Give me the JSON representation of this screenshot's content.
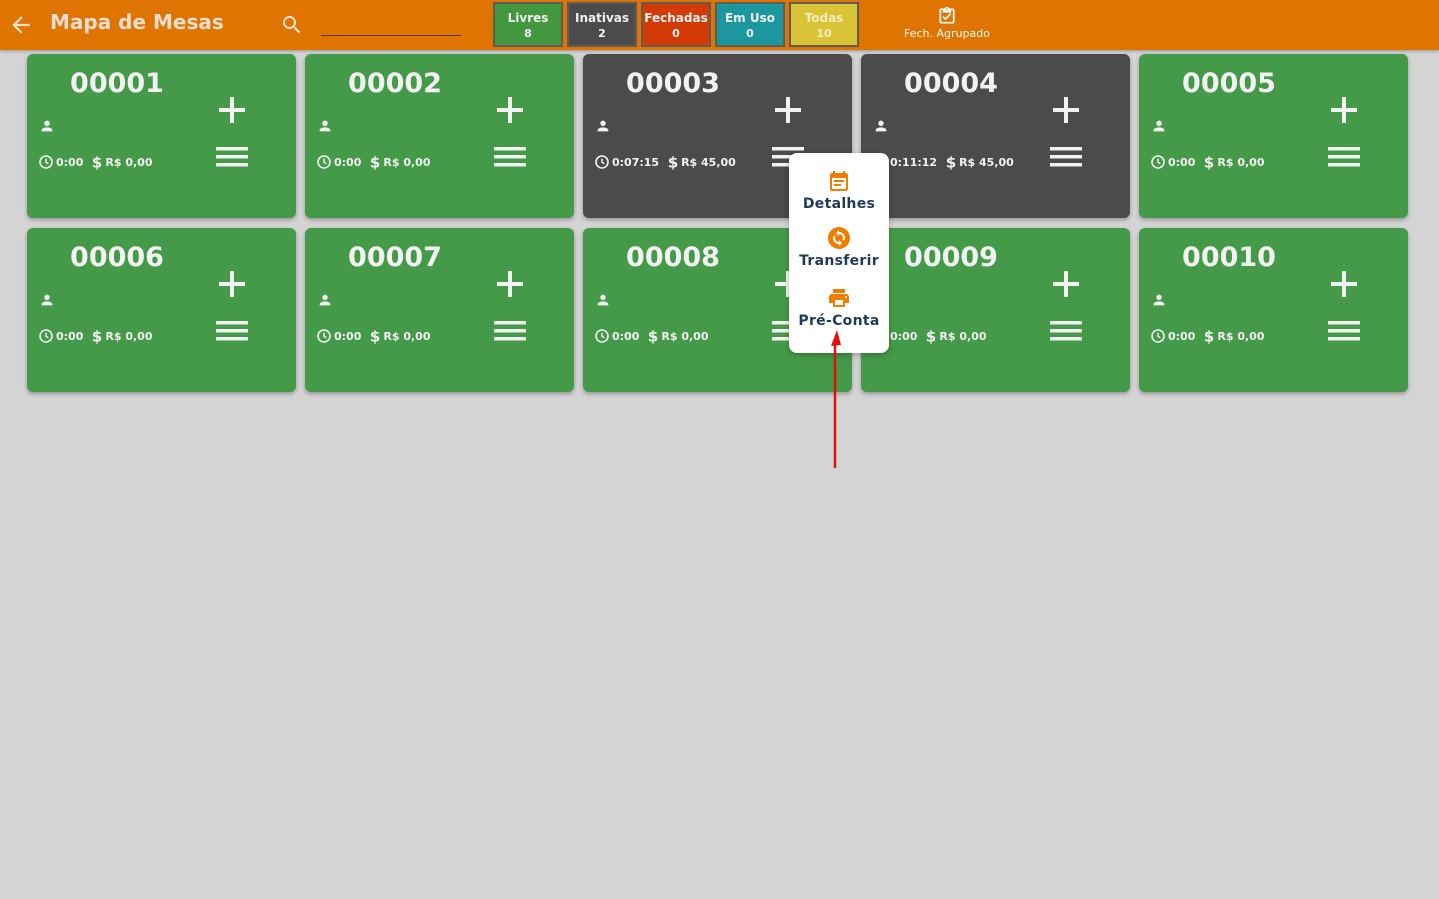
{
  "header": {
    "title": "Mapa de Mesas",
    "search_placeholder": "",
    "filters": [
      {
        "label": "Livres",
        "count": "8"
      },
      {
        "label": "Inativas",
        "count": "2"
      },
      {
        "label": "Fechadas",
        "count": "0"
      },
      {
        "label": "Em Uso",
        "count": "0"
      },
      {
        "label": "Todas",
        "count": "10"
      }
    ],
    "grouped_close_label": "Fech. Agrupado"
  },
  "tables": [
    {
      "number": "00001",
      "status": "livre",
      "time": "0:00",
      "amount": "R$ 0,00"
    },
    {
      "number": "00002",
      "status": "livre",
      "time": "0:00",
      "amount": "R$ 0,00"
    },
    {
      "number": "00003",
      "status": "inativa",
      "time": "0:07:15",
      "amount": "R$ 45,00"
    },
    {
      "number": "00004",
      "status": "inativa",
      "time": "0:11:12",
      "amount": "R$ 45,00"
    },
    {
      "number": "00005",
      "status": "livre",
      "time": "0:00",
      "amount": "R$ 0,00"
    },
    {
      "number": "00006",
      "status": "livre",
      "time": "0:00",
      "amount": "R$ 0,00"
    },
    {
      "number": "00007",
      "status": "livre",
      "time": "0:00",
      "amount": "R$ 0,00"
    },
    {
      "number": "00008",
      "status": "livre",
      "time": "0:00",
      "amount": "R$ 0,00"
    },
    {
      "number": "00009",
      "status": "livre",
      "time": "0:00",
      "amount": "R$ 0,00"
    },
    {
      "number": "00010",
      "status": "livre",
      "time": "0:00",
      "amount": "R$ 0,00"
    }
  ],
  "popup_menu": {
    "items": [
      {
        "label": "Detalhes",
        "icon": "calendar-icon"
      },
      {
        "label": "Transferir",
        "icon": "transfer-icon"
      },
      {
        "label": "Pré-Conta",
        "icon": "printer-icon"
      }
    ]
  },
  "colors": {
    "header": "#e07400",
    "livre": "#449a48",
    "inativa": "#4b4b4b",
    "fechada": "#d23a06",
    "em_uso": "#1b979d",
    "todas": "#d9c337",
    "popup_icon": "#f07c00",
    "annotation_arrow": "#e01010"
  }
}
